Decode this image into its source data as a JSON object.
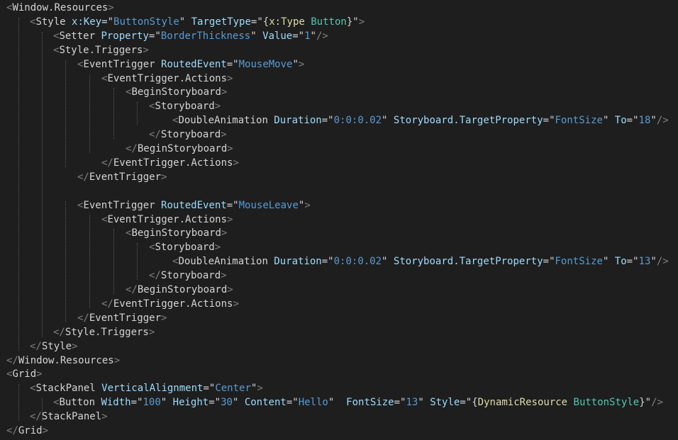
{
  "editor": {
    "language": "XAML",
    "colors": {
      "background": "#1e1e1e",
      "punctuation": "#808080",
      "tag": "#d4d4d4",
      "attribute": "#9cdcfe",
      "string": "#569cd6",
      "markup_extension": "#dcdcaa"
    },
    "lines": [
      [
        [
          "<",
          "t-punct"
        ],
        [
          "Window.Resources",
          "t-tag"
        ],
        [
          ">",
          "t-punct"
        ]
      ],
      [
        [
          "<",
          "t-punct"
        ],
        [
          "Style ",
          "t-tag"
        ],
        [
          "x:Key",
          "t-attr"
        ],
        [
          "=",
          "t-eq"
        ],
        [
          "\"",
          "t-q"
        ],
        [
          "ButtonStyle",
          "t-str"
        ],
        [
          "\" ",
          "t-q"
        ],
        [
          "TargetType",
          "t-attr"
        ],
        [
          "=",
          "t-eq"
        ],
        [
          "\"",
          "t-q"
        ],
        [
          "{",
          "t-brace"
        ],
        [
          "x:Type ",
          "t-mkw"
        ],
        [
          "Button",
          "t-mname"
        ],
        [
          "}",
          "t-brace"
        ],
        [
          "\"",
          "t-q"
        ],
        [
          ">",
          "t-punct"
        ]
      ],
      [
        [
          "<",
          "t-punct"
        ],
        [
          "Setter ",
          "t-tag"
        ],
        [
          "Property",
          "t-attr"
        ],
        [
          "=",
          "t-eq"
        ],
        [
          "\"",
          "t-q"
        ],
        [
          "BorderThickness",
          "t-str"
        ],
        [
          "\" ",
          "t-q"
        ],
        [
          "Value",
          "t-attr"
        ],
        [
          "=",
          "t-eq"
        ],
        [
          "\"",
          "t-q"
        ],
        [
          "1",
          "t-str"
        ],
        [
          "\"",
          "t-q"
        ],
        [
          "/>",
          "t-punct"
        ]
      ],
      [
        [
          "<",
          "t-punct"
        ],
        [
          "Style.Triggers",
          "t-tag"
        ],
        [
          ">",
          "t-punct"
        ]
      ],
      [
        [
          "<",
          "t-punct"
        ],
        [
          "EventTrigger ",
          "t-tag"
        ],
        [
          "RoutedEvent",
          "t-attr"
        ],
        [
          "=",
          "t-eq"
        ],
        [
          "\"",
          "t-q"
        ],
        [
          "MouseMove",
          "t-str"
        ],
        [
          "\"",
          "t-q"
        ],
        [
          ">",
          "t-punct"
        ]
      ],
      [
        [
          "<",
          "t-punct"
        ],
        [
          "EventTrigger.Actions",
          "t-tag"
        ],
        [
          ">",
          "t-punct"
        ]
      ],
      [
        [
          "<",
          "t-punct"
        ],
        [
          "BeginStoryboard",
          "t-tag"
        ],
        [
          ">",
          "t-punct"
        ]
      ],
      [
        [
          "<",
          "t-punct"
        ],
        [
          "Storyboard",
          "t-tag"
        ],
        [
          ">",
          "t-punct"
        ]
      ],
      [
        [
          "<",
          "t-punct"
        ],
        [
          "DoubleAnimation ",
          "t-tag"
        ],
        [
          "Duration",
          "t-attr"
        ],
        [
          "=",
          "t-eq"
        ],
        [
          "\"",
          "t-q"
        ],
        [
          "0:0:0.02",
          "t-str"
        ],
        [
          "\" ",
          "t-q"
        ],
        [
          "Storyboard.TargetProperty",
          "t-attr"
        ],
        [
          "=",
          "t-eq"
        ],
        [
          "\"",
          "t-q"
        ],
        [
          "FontSize",
          "t-str"
        ],
        [
          "\" ",
          "t-q"
        ],
        [
          "To",
          "t-attr"
        ],
        [
          "=",
          "t-eq"
        ],
        [
          "\"",
          "t-q"
        ],
        [
          "18",
          "t-str"
        ],
        [
          "\"",
          "t-q"
        ],
        [
          "/>",
          "t-punct"
        ]
      ],
      [
        [
          "</",
          "t-punct"
        ],
        [
          "Storyboard",
          "t-tag"
        ],
        [
          ">",
          "t-punct"
        ]
      ],
      [
        [
          "</",
          "t-punct"
        ],
        [
          "BeginStoryboard",
          "t-tag"
        ],
        [
          ">",
          "t-punct"
        ]
      ],
      [
        [
          "</",
          "t-punct"
        ],
        [
          "EventTrigger.Actions",
          "t-tag"
        ],
        [
          ">",
          "t-punct"
        ]
      ],
      [
        [
          "</",
          "t-punct"
        ],
        [
          "EventTrigger",
          "t-tag"
        ],
        [
          ">",
          "t-punct"
        ]
      ],
      [],
      [
        [
          "<",
          "t-punct"
        ],
        [
          "EventTrigger ",
          "t-tag"
        ],
        [
          "RoutedEvent",
          "t-attr"
        ],
        [
          "=",
          "t-eq"
        ],
        [
          "\"",
          "t-q"
        ],
        [
          "MouseLeave",
          "t-str"
        ],
        [
          "\"",
          "t-q"
        ],
        [
          ">",
          "t-punct"
        ]
      ],
      [
        [
          "<",
          "t-punct"
        ],
        [
          "EventTrigger.Actions",
          "t-tag"
        ],
        [
          ">",
          "t-punct"
        ]
      ],
      [
        [
          "<",
          "t-punct"
        ],
        [
          "BeginStoryboard",
          "t-tag"
        ],
        [
          ">",
          "t-punct"
        ]
      ],
      [
        [
          "<",
          "t-punct"
        ],
        [
          "Storyboard",
          "t-tag"
        ],
        [
          ">",
          "t-punct"
        ]
      ],
      [
        [
          "<",
          "t-punct"
        ],
        [
          "DoubleAnimation ",
          "t-tag"
        ],
        [
          "Duration",
          "t-attr"
        ],
        [
          "=",
          "t-eq"
        ],
        [
          "\"",
          "t-q"
        ],
        [
          "0:0:0.02",
          "t-str"
        ],
        [
          "\" ",
          "t-q"
        ],
        [
          "Storyboard.TargetProperty",
          "t-attr"
        ],
        [
          "=",
          "t-eq"
        ],
        [
          "\"",
          "t-q"
        ],
        [
          "FontSize",
          "t-str"
        ],
        [
          "\" ",
          "t-q"
        ],
        [
          "To",
          "t-attr"
        ],
        [
          "=",
          "t-eq"
        ],
        [
          "\"",
          "t-q"
        ],
        [
          "13",
          "t-str"
        ],
        [
          "\"",
          "t-q"
        ],
        [
          "/>",
          "t-punct"
        ]
      ],
      [
        [
          "</",
          "t-punct"
        ],
        [
          "Storyboard",
          "t-tag"
        ],
        [
          ">",
          "t-punct"
        ]
      ],
      [
        [
          "</",
          "t-punct"
        ],
        [
          "BeginStoryboard",
          "t-tag"
        ],
        [
          ">",
          "t-punct"
        ]
      ],
      [
        [
          "</",
          "t-punct"
        ],
        [
          "EventTrigger.Actions",
          "t-tag"
        ],
        [
          ">",
          "t-punct"
        ]
      ],
      [
        [
          "</",
          "t-punct"
        ],
        [
          "EventTrigger",
          "t-tag"
        ],
        [
          ">",
          "t-punct"
        ]
      ],
      [
        [
          "</",
          "t-punct"
        ],
        [
          "Style.Triggers",
          "t-tag"
        ],
        [
          ">",
          "t-punct"
        ]
      ],
      [
        [
          "</",
          "t-punct"
        ],
        [
          "Style",
          "t-tag"
        ],
        [
          ">",
          "t-punct"
        ]
      ],
      [
        [
          "</",
          "t-punct"
        ],
        [
          "Window.Resources",
          "t-tag"
        ],
        [
          ">",
          "t-punct"
        ]
      ],
      [
        [
          "<",
          "t-punct"
        ],
        [
          "Grid",
          "t-tag"
        ],
        [
          ">",
          "t-punct"
        ]
      ],
      [
        [
          "<",
          "t-punct"
        ],
        [
          "StackPanel ",
          "t-tag"
        ],
        [
          "VerticalAlignment",
          "t-attr"
        ],
        [
          "=",
          "t-eq"
        ],
        [
          "\"",
          "t-q"
        ],
        [
          "Center",
          "t-str"
        ],
        [
          "\"",
          "t-q"
        ],
        [
          ">",
          "t-punct"
        ]
      ],
      [
        [
          "<",
          "t-punct"
        ],
        [
          "Button ",
          "t-tag"
        ],
        [
          "Width",
          "t-attr"
        ],
        [
          "=",
          "t-eq"
        ],
        [
          "\"",
          "t-q"
        ],
        [
          "100",
          "t-str"
        ],
        [
          "\" ",
          "t-q"
        ],
        [
          "Height",
          "t-attr"
        ],
        [
          "=",
          "t-eq"
        ],
        [
          "\"",
          "t-q"
        ],
        [
          "30",
          "t-str"
        ],
        [
          "\" ",
          "t-q"
        ],
        [
          "Content",
          "t-attr"
        ],
        [
          "=",
          "t-eq"
        ],
        [
          "\"",
          "t-q"
        ],
        [
          "Hello",
          "t-str"
        ],
        [
          "\"  ",
          "t-q"
        ],
        [
          "FontSize",
          "t-attr"
        ],
        [
          "=",
          "t-eq"
        ],
        [
          "\"",
          "t-q"
        ],
        [
          "13",
          "t-str"
        ],
        [
          "\" ",
          "t-q"
        ],
        [
          "Style",
          "t-attr"
        ],
        [
          "=",
          "t-eq"
        ],
        [
          "\"",
          "t-q"
        ],
        [
          "{",
          "t-brace"
        ],
        [
          "DynamicResource ",
          "t-mkw"
        ],
        [
          "ButtonStyle",
          "t-mname"
        ],
        [
          "}",
          "t-brace"
        ],
        [
          "\"",
          "t-q"
        ],
        [
          "/>",
          "t-punct"
        ]
      ],
      [
        [
          "</",
          "t-punct"
        ],
        [
          "StackPanel",
          "t-tag"
        ],
        [
          ">",
          "t-punct"
        ]
      ],
      [
        [
          "</",
          "t-punct"
        ],
        [
          "Grid",
          "t-tag"
        ],
        [
          ">",
          "t-punct"
        ]
      ]
    ]
  }
}
